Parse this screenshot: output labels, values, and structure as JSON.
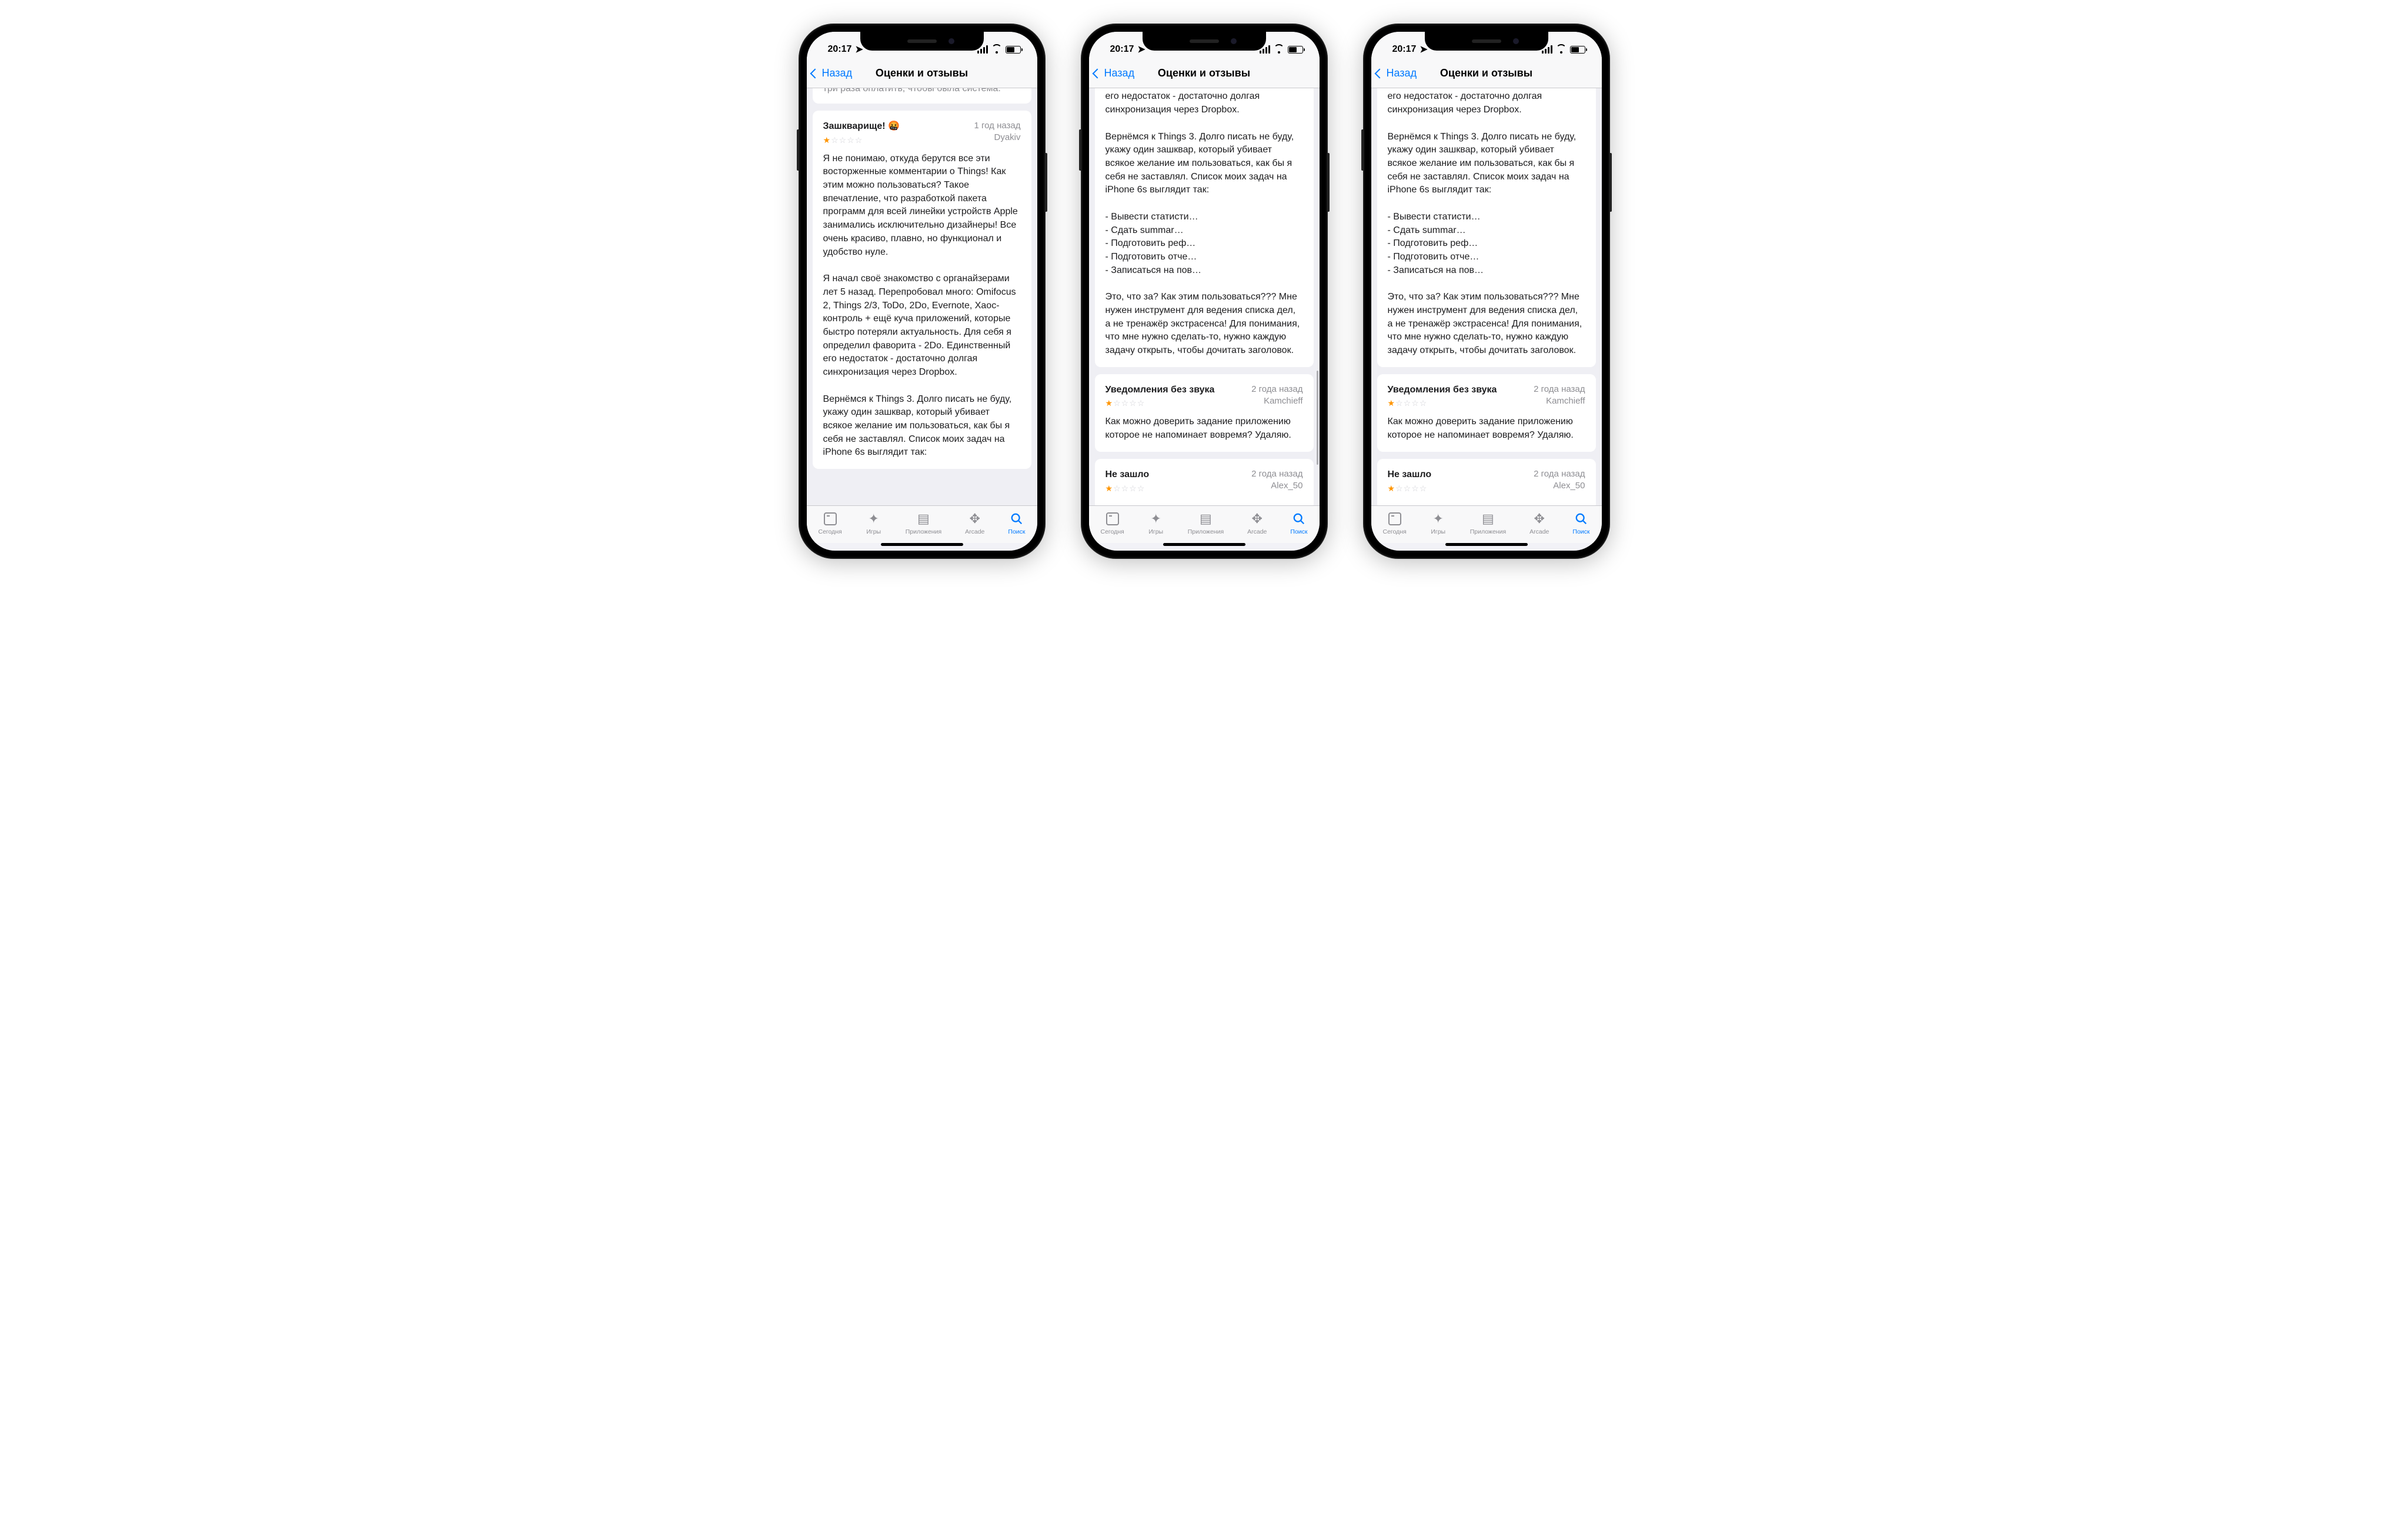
{
  "statusbar": {
    "time": "20:17"
  },
  "nav": {
    "back": "Назад",
    "title": "Оценки и отзывы"
  },
  "tabs": {
    "today": "Сегодня",
    "games": "Игры",
    "apps": "Приложения",
    "arcade": "Arcade",
    "search": "Поиск"
  },
  "cut_prev_line": "три раза оплатить, чтобы была система.",
  "reviews": [
    {
      "title": "Зашкварище! 🤬",
      "time": "1 год назад",
      "author": "Dyakiv",
      "rating": 1,
      "body_p1": "Я не понимаю, откуда берутся все эти восторженные комментарии о Things! Как этим можно пользоваться? Такое впечатление, что разработкой пакета программ для всей линейки устройств Apple занимались исключительно дизайнеры! Все очень красиво, плавно, но функционал и удобство нуле.",
      "body_p2": "Я начал своё знакомство с органайзерами лет 5 назад. Перепробовал много: Omifocus 2, Things 2/3, ToDo, 2Do, Evernote, Хаос-контроль + ещё куча приложений, которые быстро потеряли актуальность. Для себя я определил фаворита - 2Do. Единственный его недостаток - достаточно долгая синхронизация через Dropbox.",
      "body_p3": "Вернёмся к Things 3. Долго писать не буду, укажу один зашквар, который убивает всякое желание им пользоваться, как бы я себя не заставлял. Список моих задач на iPhone 6s выглядит так:",
      "list": [
        "- Вывести статисти…",
        "- Сдать summar…",
        "- Подготовить реф…",
        "- Подготовить отче…",
        "- Записаться на пов…"
      ],
      "body_p4": "Это, что за? Как этим пользоваться??? Мне нужен инструмент для ведения списка дел, а не тренажёр экстрасенса! Для понимания, что мне нужно сделать-то, нужно каждую задачу открыть, чтобы дочитать заголовок."
    },
    {
      "title": "Уведомления без звука",
      "time": "2 года назад",
      "author": "Kamchieff",
      "rating": 1,
      "body_p1": "Как можно доверить задание приложению которое не напоминает вовремя? Удаляю."
    },
    {
      "title": "Не зашло",
      "time": "2 года назад",
      "author": "Alex_50",
      "rating": 1
    }
  ]
}
